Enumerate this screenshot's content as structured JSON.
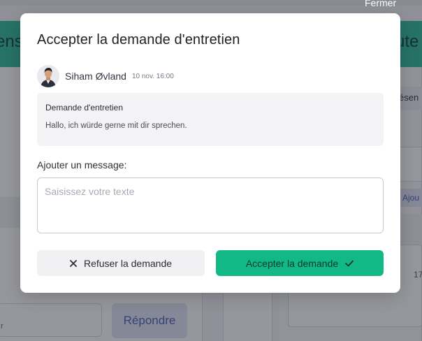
{
  "background": {
    "header_left_text": "ens",
    "header_right_text": "ute",
    "reply_button": "Répondre",
    "left_input_fragment": "r",
    "right_pill_fragment": "ésen",
    "right_chip_fragment": "Ajou",
    "right_number_fragment": "17"
  },
  "close_link": "Fermer",
  "modal": {
    "title": "Accepter la demande d'entretien",
    "sender": {
      "name": "Siham Øvland",
      "time": "10 nov. 16:00"
    },
    "request": {
      "title": "Demande d'entretien",
      "body": "Hallo, ich würde gerne mit dir sprechen."
    },
    "message_label": "Ajouter un message:",
    "message_placeholder": "Saisissez votre texte",
    "refuse_label": "Refuser la demande",
    "accept_label": "Accepter la demande"
  },
  "colors": {
    "accent": "#12b886",
    "overlay": "rgba(36,38,48,0.48)"
  }
}
